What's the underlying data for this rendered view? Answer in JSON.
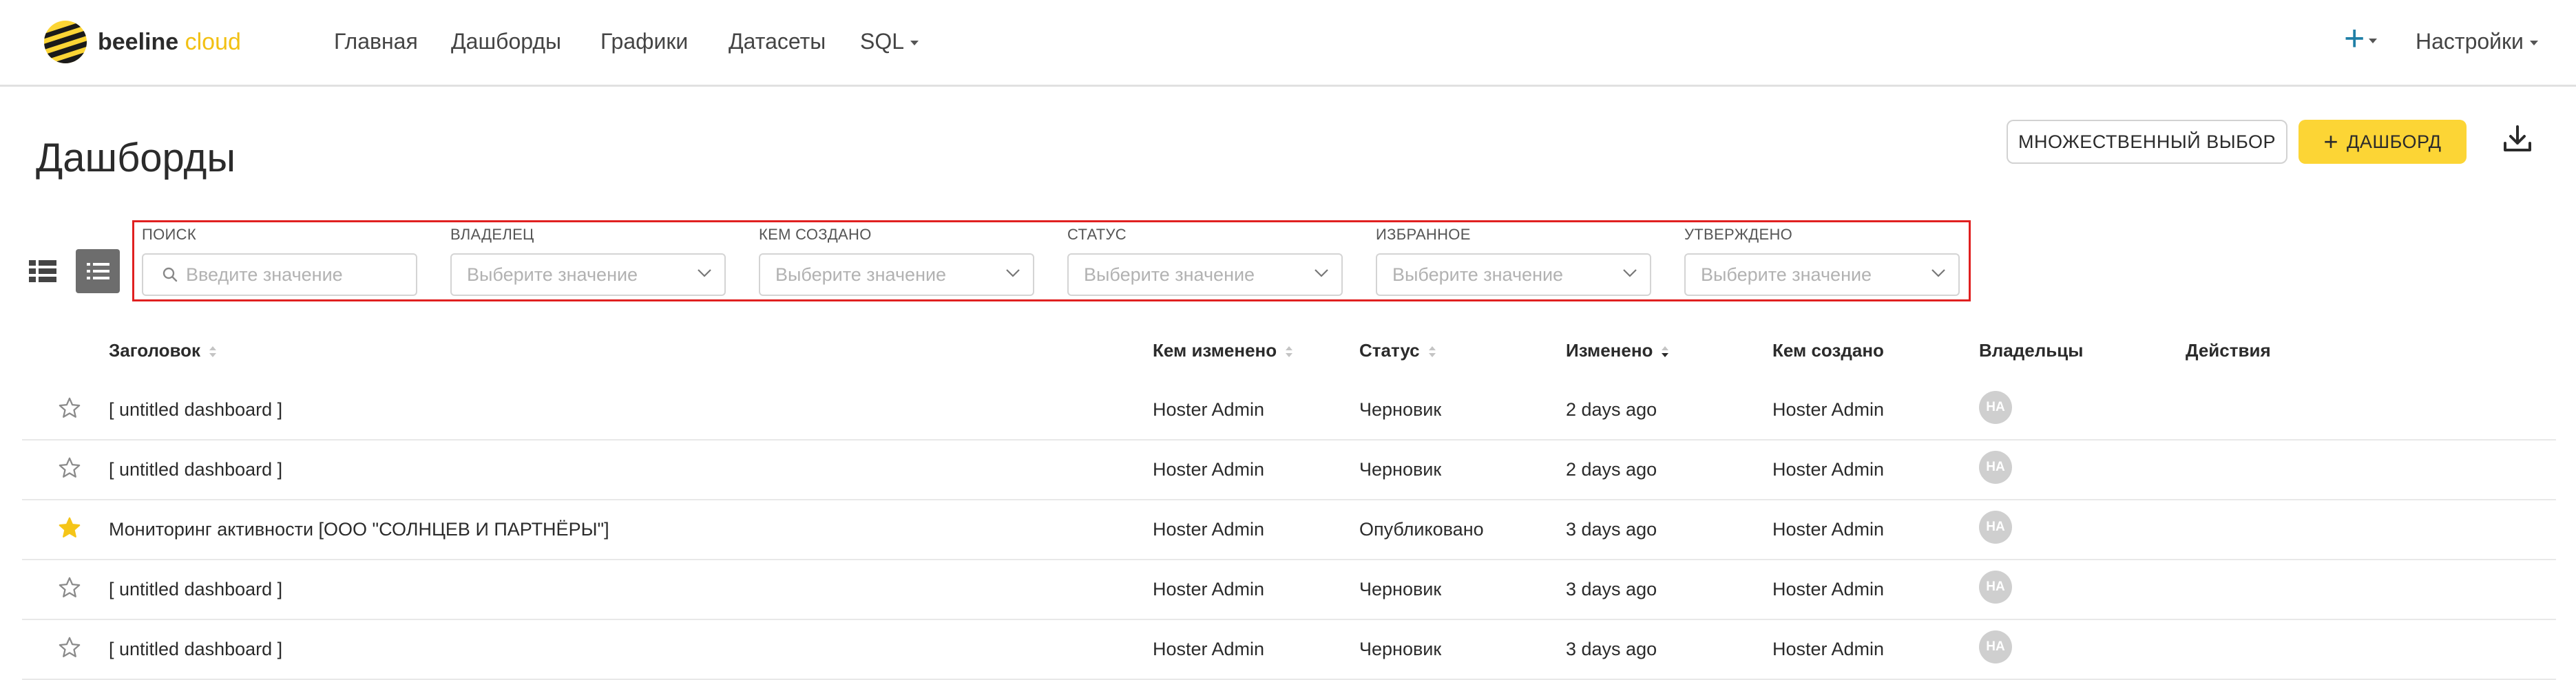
{
  "app": {
    "logo": {
      "brand": "beeline",
      "product": "cloud"
    },
    "nav": [
      "Главная",
      "Дашборды",
      "Графики",
      "Датасеты",
      "SQL"
    ],
    "settings_label": "Настройки"
  },
  "page": {
    "title": "Дашборды",
    "multi_select_label": "МНОЖЕСТВЕННЫЙ ВЫБОР",
    "add_dashboard_label": "ДАШБОРД"
  },
  "filters": {
    "search": {
      "label": "ПОИСК",
      "placeholder": "Введите значение"
    },
    "owner": {
      "label": "ВЛАДЕЛЕЦ",
      "placeholder": "Выберите значение"
    },
    "created_by": {
      "label": "КЕМ СОЗДАНО",
      "placeholder": "Выберите значение"
    },
    "status": {
      "label": "СТАТУС",
      "placeholder": "Выберите значение"
    },
    "favorite": {
      "label": "ИЗБРАННОЕ",
      "placeholder": "Выберите значение"
    },
    "approved": {
      "label": "УТВЕРЖДЕНО",
      "placeholder": "Выберите значение"
    }
  },
  "table": {
    "columns": {
      "title": "Заголовок",
      "modified_by": "Кем изменено",
      "status": "Статус",
      "modified": "Изменено",
      "created_by": "Кем создано",
      "owners": "Владельцы",
      "actions": "Действия"
    },
    "rows": [
      {
        "favorite": false,
        "title": "[ untitled dashboard ]",
        "modified_by": "Hoster Admin",
        "status": "Черновик",
        "modified": "2 days ago",
        "created_by": "Hoster Admin",
        "owner_initials": "HA"
      },
      {
        "favorite": false,
        "title": "[ untitled dashboard ]",
        "modified_by": "Hoster Admin",
        "status": "Черновик",
        "modified": "2 days ago",
        "created_by": "Hoster Admin",
        "owner_initials": "HA"
      },
      {
        "favorite": true,
        "title": "Мониторинг активности [ООО \"СОЛНЦЕВ И ПАРТНЁРЫ\"]",
        "modified_by": "Hoster Admin",
        "status": "Опубликовано",
        "modified": "3 days ago",
        "created_by": "Hoster Admin",
        "owner_initials": "HA"
      },
      {
        "favorite": false,
        "title": "[ untitled dashboard ]",
        "modified_by": "Hoster Admin",
        "status": "Черновик",
        "modified": "3 days ago",
        "created_by": "Hoster Admin",
        "owner_initials": "HA"
      },
      {
        "favorite": false,
        "title": "[ untitled dashboard ]",
        "modified_by": "Hoster Admin",
        "status": "Черновик",
        "modified": "3 days ago",
        "created_by": "Hoster Admin",
        "owner_initials": "HA"
      }
    ]
  },
  "colors": {
    "accent_yellow": "#fcd535",
    "nav_plus": "#1f7fa6",
    "highlight_border": "#e02020",
    "star_active": "#f5c518"
  }
}
